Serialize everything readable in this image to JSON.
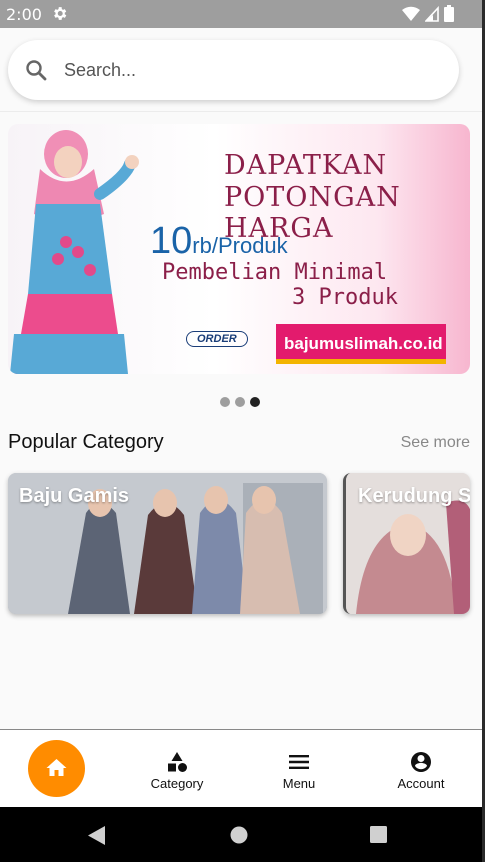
{
  "status_bar": {
    "time": "2:00",
    "icons": [
      "gear-icon",
      "wifi-icon",
      "signal-icon",
      "battery-icon"
    ]
  },
  "search": {
    "placeholder": "Search...",
    "value": ""
  },
  "banner": {
    "line1": "DAPATKAN",
    "line2": "POTONGAN HARGA",
    "price_big": "10",
    "price_unit": "rb/Produk",
    "line3": "Pembelian Minimal",
    "line4": "3 Produk",
    "order_badge": "ORDER",
    "website": "bajumuslimah.co.id"
  },
  "carousel": {
    "count": 3,
    "active_index": 2
  },
  "popular": {
    "title": "Popular Category",
    "see_more": "See more",
    "categories": [
      {
        "label": "Baju Gamis"
      },
      {
        "label": "Kerudung Segi Empat"
      }
    ]
  },
  "bottom_nav": {
    "items": [
      {
        "label": "",
        "icon": "home-icon",
        "active": true
      },
      {
        "label": "Category",
        "icon": "category-icon"
      },
      {
        "label": "Menu",
        "icon": "menu-icon"
      },
      {
        "label": "Account",
        "icon": "account-icon"
      }
    ]
  },
  "colors": {
    "accent": "#ff8c00",
    "status_bar": "#9e9e9e",
    "banner_brand": "#e31b6d"
  }
}
